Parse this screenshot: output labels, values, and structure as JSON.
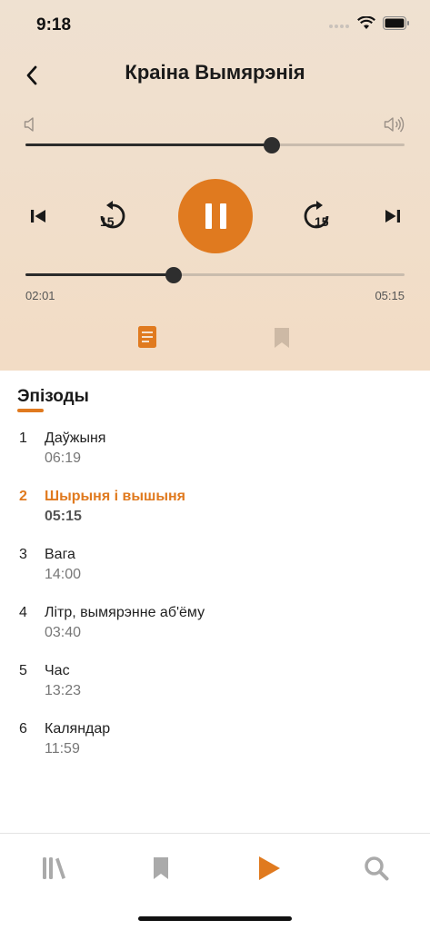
{
  "status_bar": {
    "time": "9:18"
  },
  "header": {
    "title": "Краіна Вымярэнія"
  },
  "volume": {
    "level": 0.65
  },
  "playback": {
    "progress": 0.39,
    "elapsed": "02:01",
    "duration": "05:15",
    "skip_back_label": "15",
    "skip_forward_label": "15",
    "state": "playing"
  },
  "tabs": {
    "active": "episodes-list"
  },
  "episodes_section": {
    "title": "Эпізоды",
    "items": [
      {
        "number": "1",
        "name": "Даўжыня",
        "duration": "06:19"
      },
      {
        "number": "2",
        "name": "Шырыня і вышыня",
        "duration": "05:15"
      },
      {
        "number": "3",
        "name": "Вага",
        "duration": "14:00"
      },
      {
        "number": "4",
        "name": "Літр, вымярэнне аб'ёму",
        "duration": "03:40"
      },
      {
        "number": "5",
        "name": "Час",
        "duration": "13:23"
      },
      {
        "number": "6",
        "name": "Каляндар",
        "duration": "11:59"
      }
    ],
    "active_index": 1
  },
  "colors": {
    "accent": "#e07a1f",
    "player_bg": "#f0dfcb",
    "icon_inactive": "#aaaaaa"
  },
  "bottom_nav": {
    "items": [
      {
        "icon": "library-icon"
      },
      {
        "icon": "bookmark-icon"
      },
      {
        "icon": "play-icon"
      },
      {
        "icon": "search-icon"
      }
    ],
    "active": "play-icon"
  }
}
